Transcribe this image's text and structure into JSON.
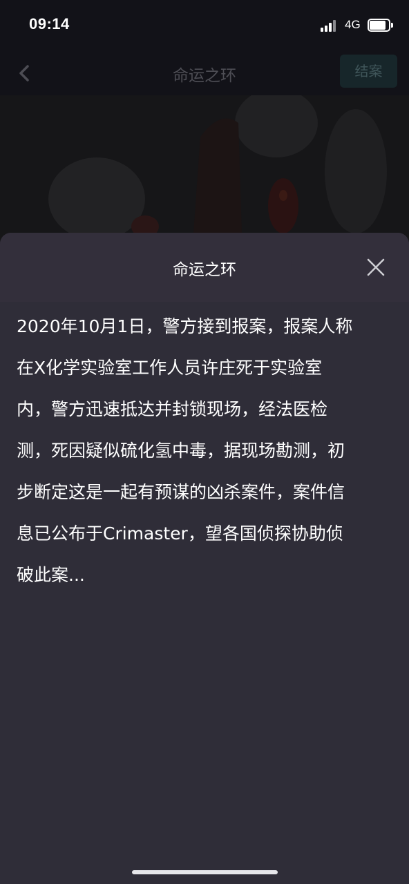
{
  "status_bar": {
    "time": "09:14",
    "network": "4G",
    "icons": [
      "signal-icon",
      "battery-icon"
    ]
  },
  "nav": {
    "back_icon": "chevron-left-icon",
    "title": "命运之环",
    "close_case_label": "结案"
  },
  "sheet": {
    "title": "命运之环",
    "close_icon": "close-icon",
    "body_lines": [
      "2020年10月1日，警方接到报案，报案人称",
      "在X化学实验室工作人员许庄死于实验室",
      "内，警方迅速抵达并封锁现场，经法医检",
      "测，死因疑似硫化氢中毒，据现场勘测，初",
      "步断定这是一起有预谋的凶杀案件，案件信",
      "息已公布于Crimaster，望各国侦探协助侦",
      "破此案..."
    ]
  },
  "colors": {
    "sheet_background": "#2f2d38",
    "sheet_header": "#332f3b",
    "dimmed_header": "#121218",
    "close_case_button": "#17262a"
  }
}
